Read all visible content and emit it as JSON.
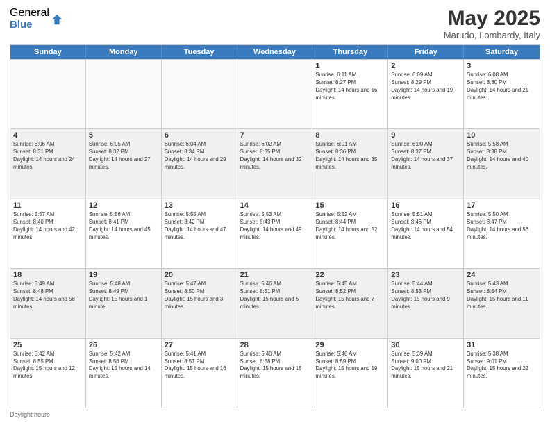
{
  "logo": {
    "general": "General",
    "blue": "Blue"
  },
  "title": "May 2025",
  "location": "Marudo, Lombardy, Italy",
  "days_of_week": [
    "Sunday",
    "Monday",
    "Tuesday",
    "Wednesday",
    "Thursday",
    "Friday",
    "Saturday"
  ],
  "footer_text": "Daylight hours",
  "weeks": [
    [
      {
        "day": "",
        "empty": true
      },
      {
        "day": "",
        "empty": true
      },
      {
        "day": "",
        "empty": true
      },
      {
        "day": "",
        "empty": true
      },
      {
        "day": "1",
        "sunrise": "6:11 AM",
        "sunset": "8:27 PM",
        "daylight": "14 hours and 16 minutes."
      },
      {
        "day": "2",
        "sunrise": "6:09 AM",
        "sunset": "8:29 PM",
        "daylight": "14 hours and 19 minutes."
      },
      {
        "day": "3",
        "sunrise": "6:08 AM",
        "sunset": "8:30 PM",
        "daylight": "14 hours and 21 minutes."
      }
    ],
    [
      {
        "day": "4",
        "sunrise": "6:06 AM",
        "sunset": "8:31 PM",
        "daylight": "14 hours and 24 minutes."
      },
      {
        "day": "5",
        "sunrise": "6:05 AM",
        "sunset": "8:32 PM",
        "daylight": "14 hours and 27 minutes."
      },
      {
        "day": "6",
        "sunrise": "6:04 AM",
        "sunset": "8:34 PM",
        "daylight": "14 hours and 29 minutes."
      },
      {
        "day": "7",
        "sunrise": "6:02 AM",
        "sunset": "8:35 PM",
        "daylight": "14 hours and 32 minutes."
      },
      {
        "day": "8",
        "sunrise": "6:01 AM",
        "sunset": "8:36 PM",
        "daylight": "14 hours and 35 minutes."
      },
      {
        "day": "9",
        "sunrise": "6:00 AM",
        "sunset": "8:37 PM",
        "daylight": "14 hours and 37 minutes."
      },
      {
        "day": "10",
        "sunrise": "5:58 AM",
        "sunset": "8:38 PM",
        "daylight": "14 hours and 40 minutes."
      }
    ],
    [
      {
        "day": "11",
        "sunrise": "5:57 AM",
        "sunset": "8:40 PM",
        "daylight": "14 hours and 42 minutes."
      },
      {
        "day": "12",
        "sunrise": "5:56 AM",
        "sunset": "8:41 PM",
        "daylight": "14 hours and 45 minutes."
      },
      {
        "day": "13",
        "sunrise": "5:55 AM",
        "sunset": "8:42 PM",
        "daylight": "14 hours and 47 minutes."
      },
      {
        "day": "14",
        "sunrise": "5:53 AM",
        "sunset": "8:43 PM",
        "daylight": "14 hours and 49 minutes."
      },
      {
        "day": "15",
        "sunrise": "5:52 AM",
        "sunset": "8:44 PM",
        "daylight": "14 hours and 52 minutes."
      },
      {
        "day": "16",
        "sunrise": "5:51 AM",
        "sunset": "8:46 PM",
        "daylight": "14 hours and 54 minutes."
      },
      {
        "day": "17",
        "sunrise": "5:50 AM",
        "sunset": "8:47 PM",
        "daylight": "14 hours and 56 minutes."
      }
    ],
    [
      {
        "day": "18",
        "sunrise": "5:49 AM",
        "sunset": "8:48 PM",
        "daylight": "14 hours and 58 minutes."
      },
      {
        "day": "19",
        "sunrise": "5:48 AM",
        "sunset": "8:49 PM",
        "daylight": "15 hours and 1 minute."
      },
      {
        "day": "20",
        "sunrise": "5:47 AM",
        "sunset": "8:50 PM",
        "daylight": "15 hours and 3 minutes."
      },
      {
        "day": "21",
        "sunrise": "5:46 AM",
        "sunset": "8:51 PM",
        "daylight": "15 hours and 5 minutes."
      },
      {
        "day": "22",
        "sunrise": "5:45 AM",
        "sunset": "8:52 PM",
        "daylight": "15 hours and 7 minutes."
      },
      {
        "day": "23",
        "sunrise": "5:44 AM",
        "sunset": "8:53 PM",
        "daylight": "15 hours and 9 minutes."
      },
      {
        "day": "24",
        "sunrise": "5:43 AM",
        "sunset": "8:54 PM",
        "daylight": "15 hours and 11 minutes."
      }
    ],
    [
      {
        "day": "25",
        "sunrise": "5:42 AM",
        "sunset": "8:55 PM",
        "daylight": "15 hours and 12 minutes."
      },
      {
        "day": "26",
        "sunrise": "5:42 AM",
        "sunset": "8:56 PM",
        "daylight": "15 hours and 14 minutes."
      },
      {
        "day": "27",
        "sunrise": "5:41 AM",
        "sunset": "8:57 PM",
        "daylight": "15 hours and 16 minutes."
      },
      {
        "day": "28",
        "sunrise": "5:40 AM",
        "sunset": "8:58 PM",
        "daylight": "15 hours and 18 minutes."
      },
      {
        "day": "29",
        "sunrise": "5:40 AM",
        "sunset": "8:59 PM",
        "daylight": "15 hours and 19 minutes."
      },
      {
        "day": "30",
        "sunrise": "5:39 AM",
        "sunset": "9:00 PM",
        "daylight": "15 hours and 21 minutes."
      },
      {
        "day": "31",
        "sunrise": "5:38 AM",
        "sunset": "9:01 PM",
        "daylight": "15 hours and 22 minutes."
      }
    ]
  ]
}
